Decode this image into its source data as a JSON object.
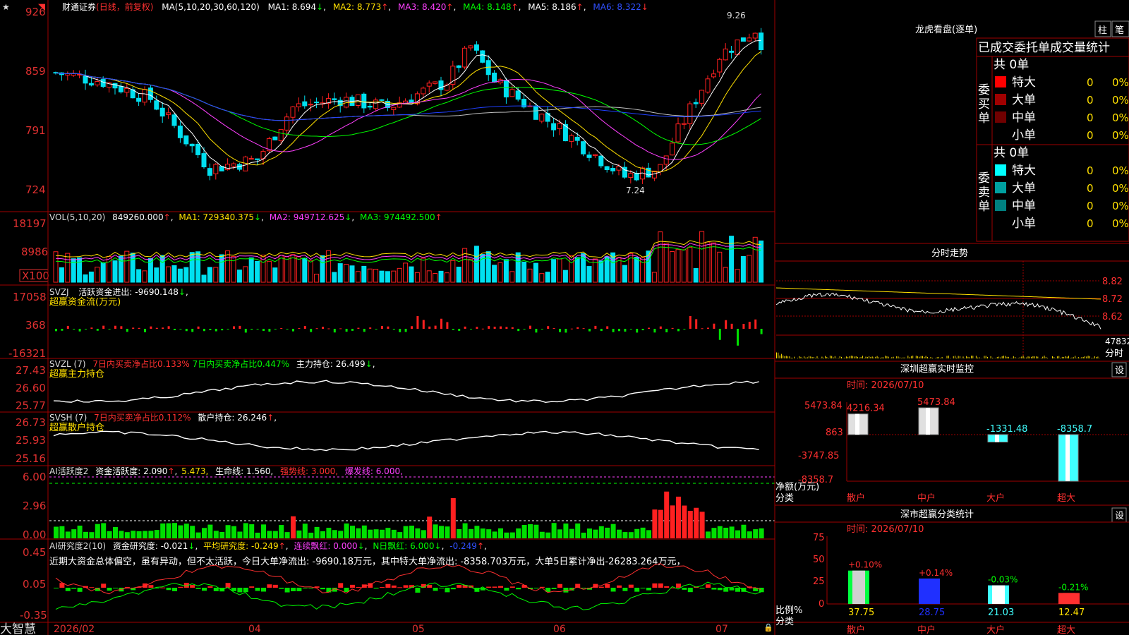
{
  "app": {
    "name": "大智慧"
  },
  "main_chart": {
    "title_prefix": "财通证券",
    "title_mode": "(日线，前复权)",
    "ma_label": "MA(5,10,20,30,60,120)",
    "ma1": "MA1: 8.694",
    "ma2": "MA2: 8.773",
    "ma3": "MA3: 8.420",
    "ma4": "MA4: 8.148",
    "ma5": "MA5: 8.186",
    "ma6": "MA6: 8.322",
    "y_ticks": [
      "926",
      "859",
      "791",
      "724"
    ],
    "high_marker": "9.26",
    "low_marker": "7.24",
    "colors": {
      "up": "#ff2020",
      "down": "#00e0f0",
      "ma1": "#ffffff",
      "ma2": "#ffe000",
      "ma3": "#ff40ff",
      "ma4": "#00ff00",
      "ma5": "#c0c0c0",
      "ma6": "#2040ff"
    }
  },
  "vol_chart": {
    "label": "VOL(5,10,20)",
    "value": "849260.000",
    "ma1": "MA1: 729340.375",
    "ma2": "MA2: 949712.625",
    "ma3": "MA3: 974492.500",
    "y_ticks": [
      "18197",
      "8986"
    ],
    "unit": "X100"
  },
  "svzj_chart": {
    "label": "SVZJ",
    "line1": "活跃资金进出: -9690.148",
    "subtitle": "超赢资金流(万元)",
    "y_ticks": [
      "17058",
      "368",
      "-16321"
    ]
  },
  "svzl_chart": {
    "label": "SVZL (7)",
    "line1": "7日内买卖净占比0.133%",
    "line2": "7日内买卖净占比0.447%",
    "line3": "主力持仓: 26.499",
    "subtitle": "超赢主力持仓",
    "y_ticks": [
      "27.43",
      "26.60",
      "25.77"
    ]
  },
  "svsh_chart": {
    "label": "SVSH (7)",
    "line1": "7日内买卖净占比0.112%",
    "line2": "散户持仓: 26.246",
    "subtitle": "超赢散户持仓",
    "y_ticks": [
      "26.73",
      "25.93",
      "25.16"
    ]
  },
  "ai_active": {
    "label": "AI活跃度2",
    "line1": "资金活跃度: 2.090",
    "line2": "5.473,",
    "line3": "生命线: 1.560,",
    "line4": "强势线: 3.000,",
    "line5": "爆发线: 6.000,",
    "y_ticks": [
      "6.00",
      "2.96",
      "0.00"
    ]
  },
  "ai_research": {
    "label": "AI研究度2(10)",
    "line1": "资金研究度: -0.021",
    "line2": "平均研究度: -0.249",
    "line3": "连续飘红: 0.000",
    "line4": "N日飘红: 6.000",
    "line5": "-0.249",
    "comment": "近期大资金总体偏空，虽有异动，但不太活跃，今日大单净流出: -9690.18万元，其中特大单净流出: -8358.703万元，大单5日累计净出-26283.264万元，",
    "y_ticks": [
      "0.45",
      "0.05",
      "-0.35"
    ]
  },
  "x_axis": {
    "labels": [
      "2026/02",
      "04",
      "05",
      "06",
      "07"
    ]
  },
  "lhb": {
    "title": "龙虎看盘(逐单)",
    "btn_bar": "柱",
    "btn_pen": "笔",
    "tabs": [
      "已成交",
      "委托单",
      "成交量统计"
    ],
    "buy": {
      "side_label": "委买单",
      "count": "共 0单",
      "rows": [
        {
          "name": "特大",
          "val": "0",
          "pct": "0%",
          "color": "#ff0000"
        },
        {
          "name": "大单",
          "val": "0",
          "pct": "0%",
          "color": "#a00000"
        },
        {
          "name": "中单",
          "val": "0",
          "pct": "0%",
          "color": "#700000"
        },
        {
          "name": "小单",
          "val": "0",
          "pct": "0%",
          "color": ""
        }
      ]
    },
    "sell": {
      "side_label": "委卖单",
      "count": "共 0单",
      "rows": [
        {
          "name": "特大",
          "val": "0",
          "pct": "0%",
          "color": "#00ffff"
        },
        {
          "name": "大单",
          "val": "0",
          "pct": "0%",
          "color": "#00a0a0"
        },
        {
          "name": "中单",
          "val": "0",
          "pct": "0%",
          "color": "#008080"
        },
        {
          "name": "小单",
          "val": "0",
          "pct": "0%",
          "color": ""
        }
      ]
    }
  },
  "intraday": {
    "title": "分时走势",
    "y_ticks": [
      "8.82",
      "8.72",
      "8.62"
    ],
    "vol_label": "47832",
    "unit": "分时"
  },
  "monitor": {
    "title": "深圳超赢实时监控",
    "settings": "设",
    "time": "时间: 2026/07/10",
    "y_ticks": [
      "5473.84",
      "863",
      "-3747.85",
      "-8358.7"
    ],
    "axis_label_1": "净额(万元)",
    "axis_label_2": "分类",
    "categories": [
      "散户",
      "中户",
      "大户",
      "超大"
    ]
  },
  "classify": {
    "title": "深市超赢分类统计",
    "settings": "设",
    "time": "时间: 2026/07/10",
    "y_ticks": [
      "75",
      "50",
      "25",
      "0"
    ],
    "axis_label_1": "比例%",
    "axis_label_2": "分类",
    "categories": [
      "散户",
      "中户",
      "大户",
      "超大"
    ]
  },
  "chart_data": [
    {
      "type": "bar",
      "title": "深圳超赢实时监控",
      "categories": [
        "散户",
        "中户",
        "大户",
        "超大"
      ],
      "values": [
        4216.34,
        5473.84,
        -1331.48,
        -8358.7
      ],
      "ylabel": "净额(万元)",
      "xlabel": "分类",
      "ylim": [
        -8358.7,
        5473.84
      ]
    },
    {
      "type": "bar",
      "title": "深市超赢分类统计",
      "categories": [
        "散户",
        "中户",
        "大户",
        "超大"
      ],
      "values": [
        37.75,
        28.75,
        21.03,
        12.47
      ],
      "change_labels": [
        "+0.10%",
        "+0.14%",
        "-0.03%",
        "-0.21%"
      ],
      "ylabel": "比例%",
      "xlabel": "分类",
      "ylim": [
        0,
        75
      ]
    }
  ]
}
